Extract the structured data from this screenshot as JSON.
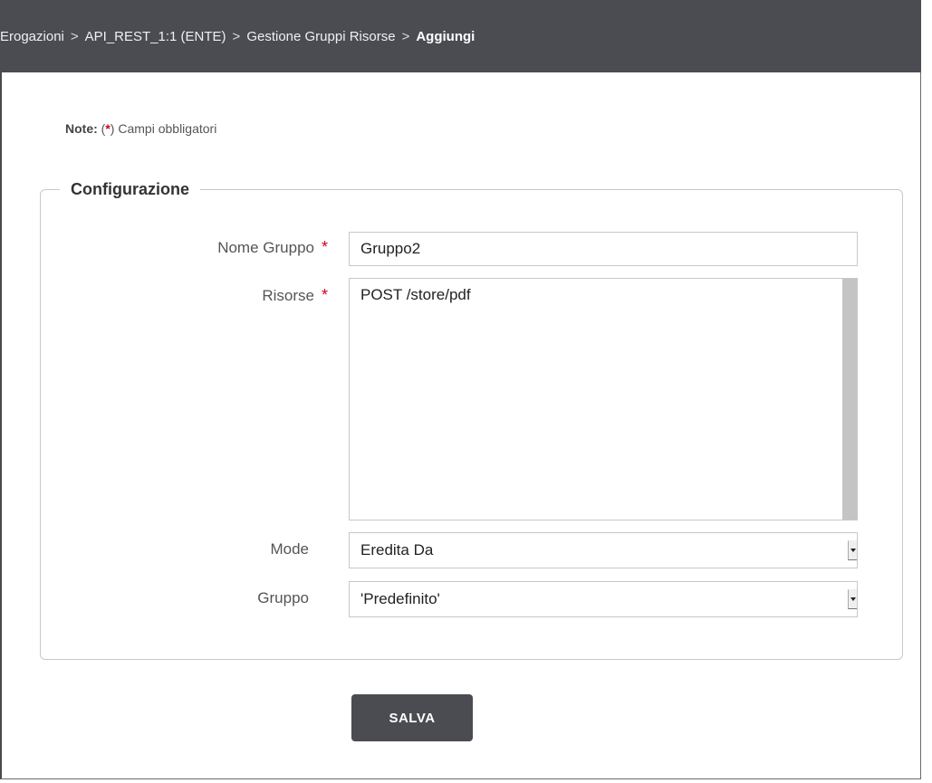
{
  "breadcrumb": {
    "items": [
      "Erogazioni",
      "API_REST_1:1 (ENTE)",
      "Gestione Gruppi Risorse"
    ],
    "current": "Aggiungi",
    "separator": ">"
  },
  "note": {
    "label": "Note:",
    "open_paren": "(",
    "star": "*",
    "close_paren": ")",
    "text": "Campi obbligatori"
  },
  "form": {
    "legend": "Configurazione",
    "required_marker": "*",
    "nome_gruppo": {
      "label": "Nome Gruppo",
      "value": "Gruppo2"
    },
    "risorse": {
      "label": "Risorse",
      "options": [
        "POST /store/pdf"
      ]
    },
    "mode": {
      "label": "Mode",
      "selected": "Eredita Da"
    },
    "gruppo": {
      "label": "Gruppo",
      "selected": "'Predefinito'"
    }
  },
  "actions": {
    "save_label": "SALVA"
  },
  "colors": {
    "header_bg": "#4b4b52",
    "required": "#d0021b",
    "button_bg": "#4b4b52"
  }
}
